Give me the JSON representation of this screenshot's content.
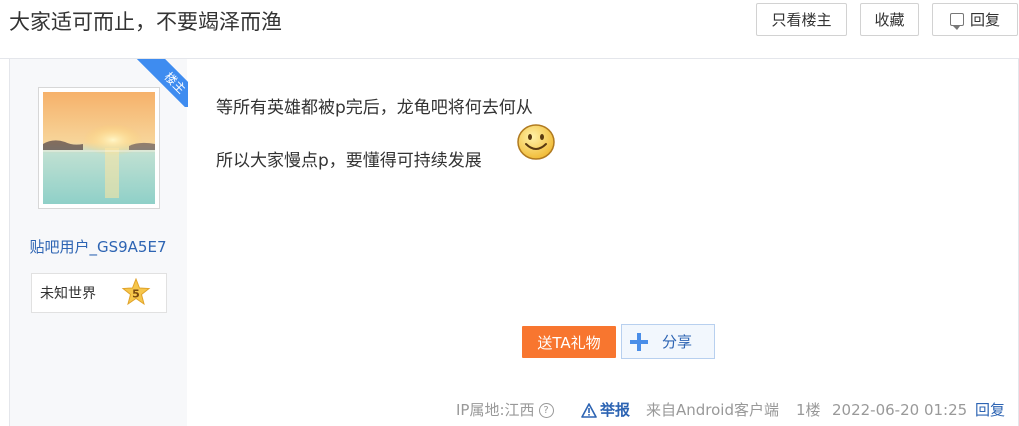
{
  "thread": {
    "title": "大家适可而止，不要竭泽而渔"
  },
  "header_buttons": {
    "only_lz": "只看楼主",
    "collect": "收藏",
    "reply": "回复"
  },
  "author": {
    "badge": "楼主",
    "username": "贴吧用户_GS9A5E7",
    "level_name": "未知世界",
    "level_num": "5"
  },
  "post": {
    "lines": [
      "等所有英雄都被p完后，龙龟吧将何去何从",
      "所以大家慢点p，要懂得可持续发展"
    ],
    "emoji_icon": "smiley-face-icon"
  },
  "actions": {
    "gift": "送TA礼物",
    "share": "分享"
  },
  "meta": {
    "ip": "IP属地:江西",
    "help": "?",
    "report": "举报",
    "from": "来自Android客户端",
    "floor": "1楼",
    "time": "2022-06-20 01:25",
    "reply": "回复"
  },
  "colors": {
    "link": "#2d64b3",
    "gift": "#f8762f",
    "badge": "#3e8cf0"
  }
}
